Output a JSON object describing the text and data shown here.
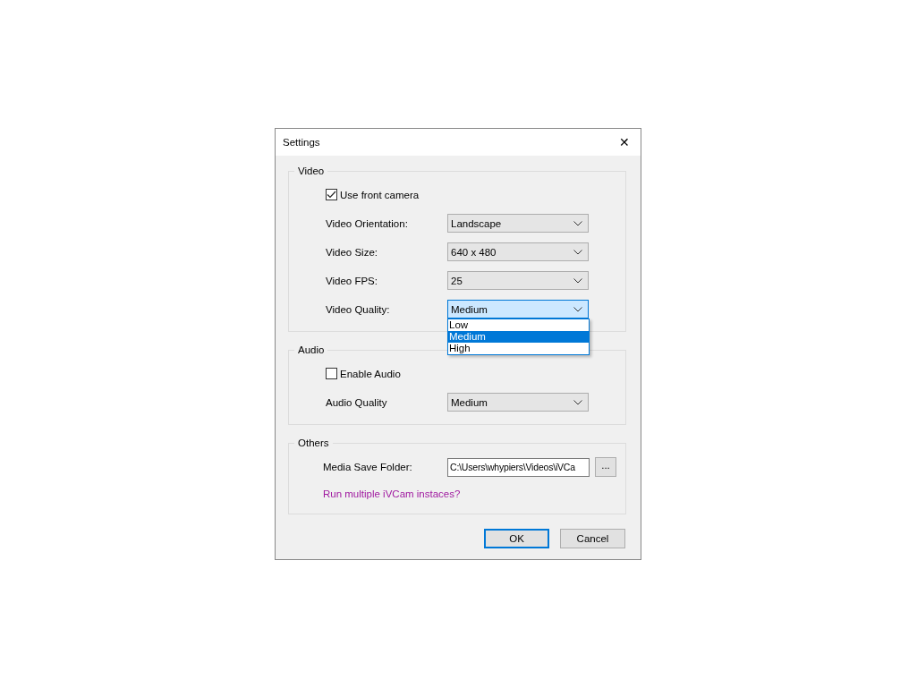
{
  "window": {
    "title": "Settings",
    "close": "✕"
  },
  "groups": [
    {
      "legend": "Video",
      "rows": [
        {
          "kind": "checkbox",
          "label": "Use front camera",
          "checked": true
        },
        {
          "kind": "combo",
          "label": "Video Orientation:",
          "value": "Landscape",
          "open": false
        },
        {
          "kind": "combo",
          "label": "Video Size:",
          "value": "640 x 480",
          "open": false
        },
        {
          "kind": "combo",
          "label": "Video FPS:",
          "value": "25",
          "open": false
        },
        {
          "kind": "combo",
          "label": "Video Quality:",
          "value": "Medium",
          "open": true,
          "options": [
            {
              "label": "Low",
              "selected": false
            },
            {
              "label": "Medium",
              "selected": true
            },
            {
              "label": "High",
              "selected": false
            }
          ]
        }
      ]
    },
    {
      "legend": "Audio",
      "rows": [
        {
          "kind": "checkbox",
          "label": "Enable Audio",
          "checked": false
        },
        {
          "kind": "combo",
          "label": "Audio Quality",
          "value": "Medium",
          "open": false
        }
      ]
    },
    {
      "legend": "Others",
      "rows": [
        {
          "kind": "path",
          "label": "Media Save Folder:",
          "value": "C:\\Users\\whypiers\\Videos\\iVCa",
          "browse": "..."
        },
        {
          "kind": "link",
          "label": "Run multiple iVCam instaces?"
        }
      ]
    }
  ],
  "buttons": [
    {
      "label": "OK",
      "default": true
    },
    {
      "label": "Cancel",
      "default": false
    }
  ]
}
